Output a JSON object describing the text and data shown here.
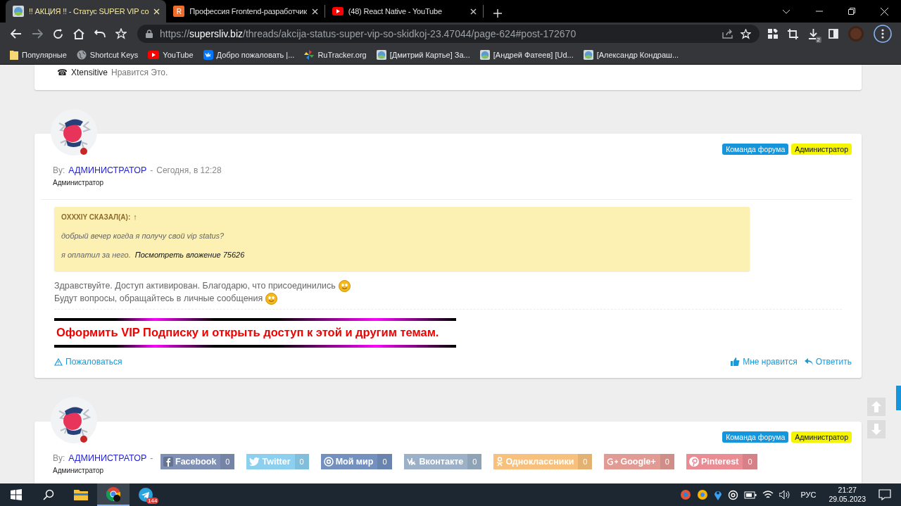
{
  "browser": {
    "tabs": [
      {
        "title": "!! АКЦИЯ !! - Статус SUPER VIP со",
        "kind": "site",
        "selected": true
      },
      {
        "title": "Профессия Frontend-разработчик",
        "kind": "letter",
        "letter": "R",
        "selected": false
      },
      {
        "title": "(48) React Native - YouTube",
        "kind": "video",
        "selected": false
      }
    ],
    "url": {
      "scheme": "https://",
      "host": "supersliv.biz",
      "path": "/threads/akcija-status-super-vip-so-skidkoj-23.47044/page-624#post-172670"
    },
    "downloads_badge": "2",
    "bookmarks": [
      {
        "label": "Популярные",
        "kind": "folder"
      },
      {
        "label": "Shortcut Keys",
        "kind": "globe"
      },
      {
        "label": "YouTube",
        "kind": "video"
      },
      {
        "label": "Добро пожаловать |...",
        "kind": "vk"
      },
      {
        "label": "RuTracker.org",
        "kind": "tracker"
      },
      {
        "label": "[Дмитрий Картье] За...",
        "kind": "site"
      },
      {
        "label": "[Андрей Фатеев] [Ud...",
        "kind": "site"
      },
      {
        "label": "[Александр Кондраш...",
        "kind": "site"
      }
    ]
  },
  "previous_post": {
    "like_icon": "☎",
    "like_user": "Xtensitive",
    "like_text": "Нравится Это."
  },
  "posts": [
    {
      "badges": [
        {
          "label": "Команда форума",
          "kind": "team"
        },
        {
          "label": "Администратор",
          "kind": "admin"
        }
      ],
      "by": "By:",
      "author": "АДМИНИСТРАТОР",
      "separator": "-",
      "date": "Сегодня, в 12:28",
      "user_title": "Администратор",
      "quote": {
        "author": "OXXXIY СКАЗАЛ(А):",
        "arrow": "↑",
        "lines": [
          "добрый вечер когда я получу свой vip status?"
        ],
        "last_line": "я оплатил за него.",
        "link": "Посмотреть вложение 75626"
      },
      "body": [
        {
          "text": "Здравствуйте. Доступ активирован. Благодарю, что присоединились",
          "smiley": true
        },
        {
          "text": "Будут вопросы, обращайтесь в личные сообщения",
          "smiley": true
        }
      ],
      "promo": "Оформить VIP Подписку и открыть доступ к этой и другим темам.",
      "report": "Пожаловаться",
      "like": "Мне нравится",
      "reply": "Ответить"
    },
    {
      "badges": [
        {
          "label": "Команда форума",
          "kind": "team"
        },
        {
          "label": "Администратор",
          "kind": "admin"
        }
      ],
      "by": "By:",
      "author": "АДМИНИСТРАТОР",
      "separator": "-",
      "user_title": "Администратор"
    }
  ],
  "share": [
    {
      "label": "Facebook",
      "count": "0",
      "kind": "facebook",
      "color": "#7f90b4"
    },
    {
      "label": "Twitter",
      "count": "0",
      "kind": "twitter",
      "color": "#8ccfee"
    },
    {
      "label": "Мой мир",
      "count": "0",
      "kind": "mail",
      "color": "#7490bf"
    },
    {
      "label": "Вконтакте",
      "count": "0",
      "kind": "vk",
      "color": "#9cb1c7"
    },
    {
      "label": "Одноклассники",
      "count": "0",
      "kind": "ok",
      "color": "#f7c07c"
    },
    {
      "label": "Google+",
      "count": "0",
      "kind": "gplus",
      "color": "#e29b94"
    },
    {
      "label": "Pinterest",
      "count": "0",
      "kind": "pinterest",
      "color": "#e98c94"
    }
  ],
  "taskbar": {
    "apps": [
      {
        "kind": "explorer",
        "selected": false
      },
      {
        "kind": "chrome",
        "selected": true
      },
      {
        "kind": "telegram",
        "selected": false,
        "badge": "144"
      }
    ],
    "language": "РУС",
    "time": "21:27",
    "date": "29.05.2023"
  }
}
